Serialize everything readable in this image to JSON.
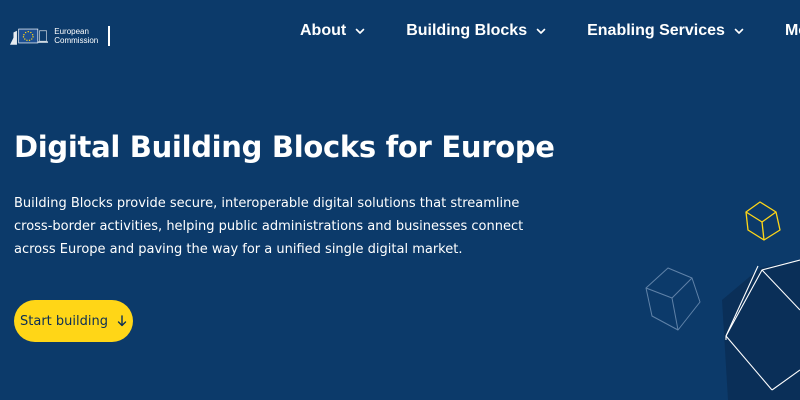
{
  "brand": {
    "line1": "European",
    "line2": "Commission"
  },
  "nav": {
    "items": [
      {
        "label": "About"
      },
      {
        "label": "Building Blocks"
      },
      {
        "label": "Enabling Services"
      },
      {
        "label": "Monitoring"
      }
    ]
  },
  "hero": {
    "title": "Digital Building Blocks for Europe",
    "description": "Building Blocks provide secure, interoperable digital solutions that streamline cross-border activities, helping public administrations and businesses connect across Europe and paving the way for a unified single digital market.",
    "cta_label": "Start building",
    "cta_icon": "arrow-down-icon"
  },
  "colors": {
    "background": "#0c3a6a",
    "accent_yellow": "#ffd617",
    "text": "#ffffff"
  }
}
